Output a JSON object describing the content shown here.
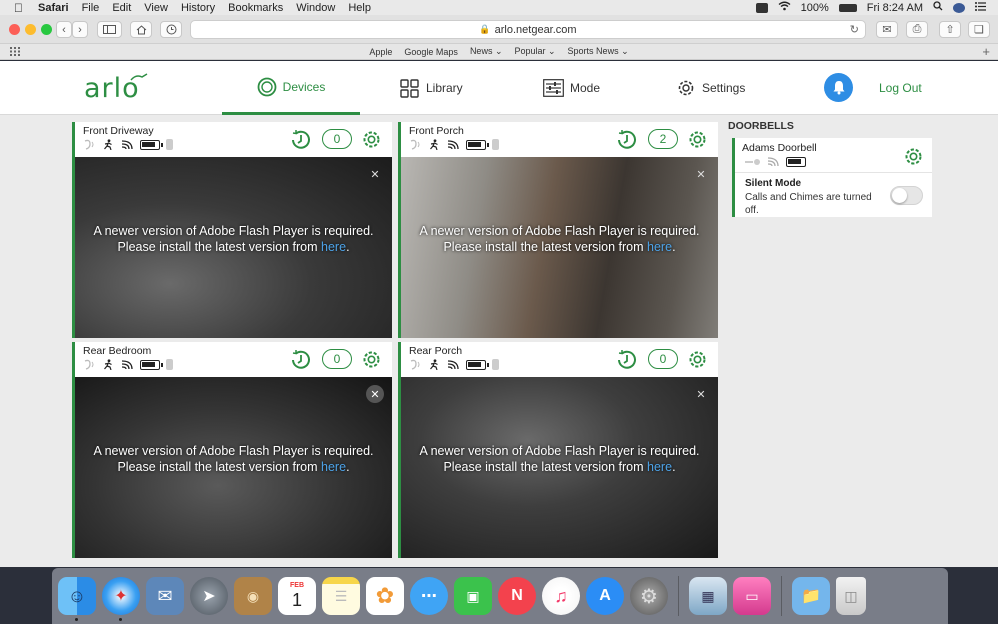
{
  "menubar": {
    "app_name": "Safari",
    "items": [
      "File",
      "Edit",
      "View",
      "History",
      "Bookmarks",
      "Window",
      "Help"
    ],
    "battery": "100%",
    "clock": "Fri 8:24 AM"
  },
  "browser": {
    "url": "arlo.netgear.com",
    "favorites": [
      "Apple",
      "Google Maps",
      "News ⌄",
      "Popular ⌄",
      "Sports News ⌄"
    ]
  },
  "nav": {
    "logo": "arlo",
    "tabs": [
      {
        "label": "Devices",
        "icon": "devices-ring-icon"
      },
      {
        "label": "Library",
        "icon": "library-grid-icon"
      },
      {
        "label": "Mode",
        "icon": "mode-sliders-icon"
      },
      {
        "label": "Settings",
        "icon": "gear-icon"
      }
    ],
    "logout": "Log Out"
  },
  "flash_message": {
    "line1": "A newer version of Adobe Flash Player is required.",
    "line2_prefix": "Please install the latest version from ",
    "link": "here",
    "line2_suffix": "."
  },
  "cameras": [
    {
      "name": "Front Driveway",
      "count": "0"
    },
    {
      "name": "Front Porch",
      "count": "2"
    },
    {
      "name": "Rear Bedroom",
      "count": "0"
    },
    {
      "name": "Rear Porch",
      "count": "0"
    }
  ],
  "doorbells": {
    "heading": "DOORBELLS",
    "name": "Adams Doorbell",
    "silent_title": "Silent Mode",
    "silent_desc": "Calls and Chimes are turned off.",
    "silent_on": false
  },
  "colors": {
    "accent": "#2d8e43",
    "bell": "#2e8de4",
    "link": "#4da3e8"
  },
  "dock": {
    "apps": [
      "Finder",
      "Safari",
      "Mail",
      "Launchpad",
      "Contacts",
      "Calendar",
      "Notes",
      "Photos",
      "Messages",
      "FaceTime",
      "News",
      "Music",
      "App Store",
      "System Preferences",
      "Preview",
      "CleanMyMac",
      "Downloads",
      "Trash"
    ],
    "calendar_month": "FEB",
    "calendar_day": "1"
  }
}
